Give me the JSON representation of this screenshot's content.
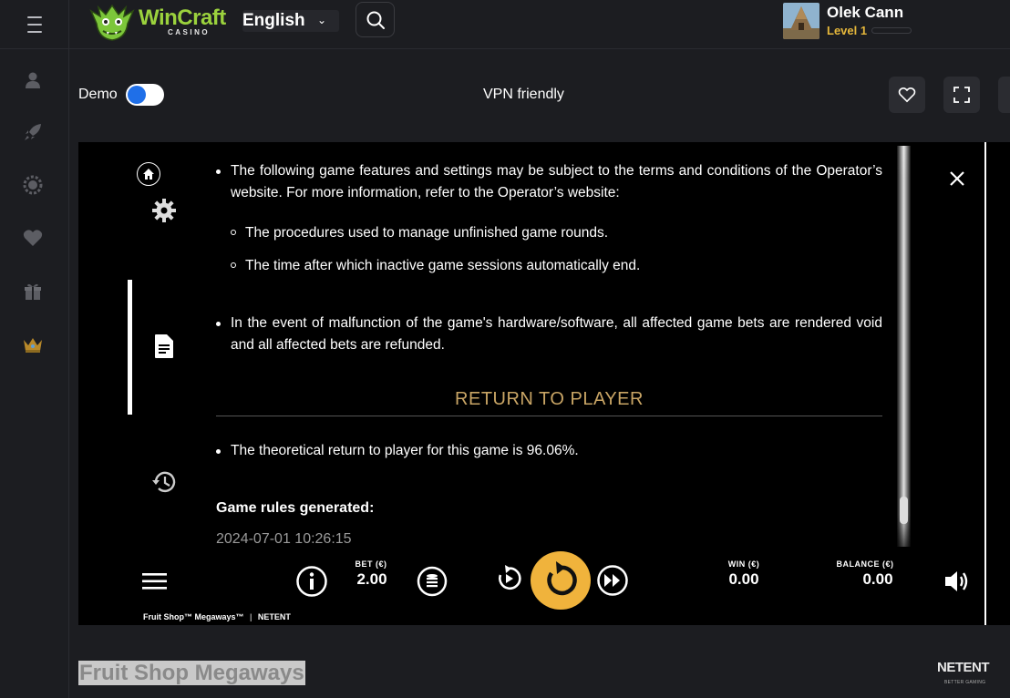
{
  "header": {
    "brand": "WinCraft",
    "brand_sub": "CASINO",
    "language": "English",
    "user_name": "Olek Cann",
    "user_level": "Level 1"
  },
  "controls": {
    "demo_label": "Demo",
    "demo_on": true,
    "vpn_label": "VPN friendly"
  },
  "rules": {
    "bullet1": "The following game features and settings may be subject to the terms and conditions of the Operator’s website. For more information, refer to the Operator’s website:",
    "sub1": "The procedures used to manage unfinished game rounds.",
    "sub2": "The time after which inactive game sessions automatically end.",
    "bullet2": "In the event of malfunction of the game's hardware/software, all affected game bets are rendered void and all affected bets are refunded.",
    "rtp_heading": "RETURN TO PLAYER",
    "rtp_text": "The theoretical return to player for this game is 96.06%.",
    "generated_label": "Game rules generated:",
    "generated_date": "2024-07-01 10:26:15"
  },
  "game_bar": {
    "bet_label": "BET (€)",
    "bet_value": "2.00",
    "win_label": "WIN (€)",
    "win_value": "0.00",
    "balance_label": "BALANCE (€)",
    "balance_value": "0.00",
    "footer_game": "Fruit Shop™ Megaways™",
    "footer_provider": "NETENT"
  },
  "page": {
    "game_title": "Fruit Shop Megaways",
    "provider_logo": "NETENT",
    "provider_tagline": "BETTER GAMING"
  },
  "colors": {
    "accent_gold": "#c9a565",
    "spin_orange": "#f0b33c",
    "level_yellow": "#e5b73b",
    "brand_green": "#9bd23d",
    "toggle_blue": "#1f6fe8"
  },
  "icons": [
    "menu-icon",
    "search-icon",
    "user-icon",
    "rocket-icon",
    "roulette-icon",
    "heart-icon",
    "gift-icon",
    "crown-icon",
    "favorite-heart-icon",
    "fullscreen-icon",
    "home-icon",
    "gear-icon",
    "document-icon",
    "history-icon",
    "close-icon",
    "hamburger-icon",
    "info-icon",
    "coins-icon",
    "autoplay-icon",
    "spin-icon",
    "turbo-icon",
    "sound-icon"
  ]
}
